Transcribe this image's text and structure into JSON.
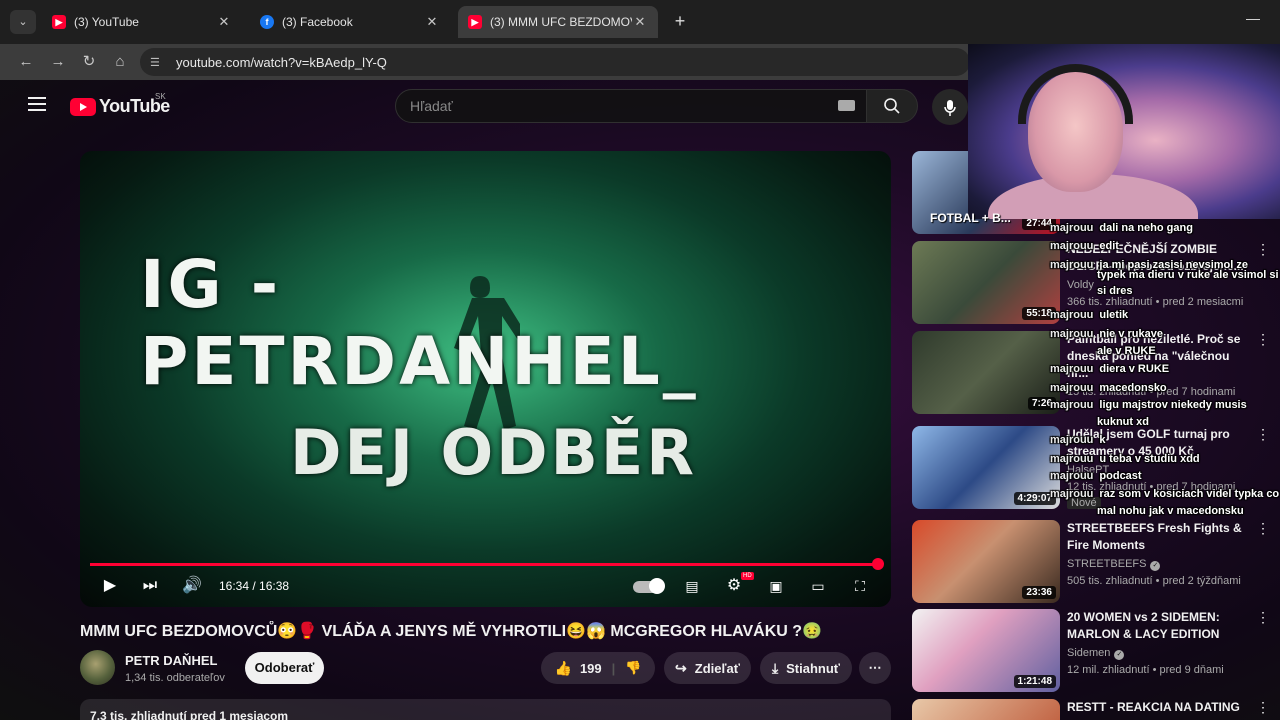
{
  "browser": {
    "tabs": [
      {
        "label": "(3) YouTube",
        "icon": "youtube-icon"
      },
      {
        "label": "(3) Facebook",
        "icon": "facebook-icon"
      },
      {
        "label": "(3) MMM UFC BEZDOMOVCŮ😳",
        "icon": "youtube-icon"
      }
    ],
    "url": "youtube.com/watch?v=kBAedp_lY-Q"
  },
  "yt": {
    "logo": "YouTube",
    "country": "SK",
    "search_placeholder": "Hľadať"
  },
  "player": {
    "overlay_line1": "IG - PETRDANHEL_",
    "overlay_line2": "DEJ ODBĚR",
    "time": "16:34 / 16:38",
    "progress": 0.996,
    "hd_badge": "HD"
  },
  "video": {
    "title": "MMM UFC BEZDOMOVCŮ😳🥊 VLÁĎA A JENYS MĚ VYHROTILI😆😱 MCGREGOR HLAVÁKU ?🤢",
    "channel": "PETR DAŇHEL",
    "subscribers": "1,34 tis. odberateľov",
    "subscribe_label": "Odoberať",
    "likes": "199",
    "share_label": "Zdieľať",
    "download_label": "Stiahnuť",
    "description_preview": "7,3 tis. zhliadnutí  pred 1 mesiacom"
  },
  "recommendations": [
    {
      "title": "FOTBAL + B...",
      "duration": "27:44",
      "channel": "",
      "meta": ""
    },
    {
      "title": "NEBEZPEČNĚJŠÍ ZOMBIE OLICE – Doprovod ozbrojené...",
      "duration": "55:18",
      "channel": "Voldy",
      "meta": "366 tis. zhliadnutí • pred 2 mesiacmi"
    },
    {
      "title": "Paintball pro neziletlé. Proč se dneska pohled na \"válečnou hr...",
      "duration": "7:26",
      "channel": "",
      "meta": "15 tis. zhliadnutí • pred 7 hodinami"
    },
    {
      "title": "Udělal jsem GOLF turnaj pro streamery o 45 000 Kč",
      "duration": "4:29:07",
      "channel": "HalsePT",
      "meta": "12 tis. zhliadnutí • pred 7 hodinami",
      "badge": "Nové"
    },
    {
      "title": "STREETBEEFS Fresh Fights & Fire Moments",
      "duration": "23:36",
      "channel": "STREETBEEFS",
      "meta": "505 tis. zhliadnutí • pred 2 týždňami"
    },
    {
      "title": "20 WOMEN vs 2 SIDEMEN: MARLON & LACY EDITION",
      "duration": "1:21:48",
      "channel": "Sidemen",
      "meta": "12 mil. zhliadnutí • pred 9 dňami"
    },
    {
      "title": "RESTT - REAKCIA NA DATING",
      "duration": "",
      "channel": "",
      "meta": ""
    }
  ],
  "chat": [
    {
      "user": "majrouu",
      "text": "dali na neho gang"
    },
    {
      "user": "majrouu",
      "text": "edit"
    },
    {
      "user": "majrouu",
      "text": "ja mi pasi zasisi nevsimol ze"
    },
    {
      "user": "",
      "text": "typek ma dieru v ruke ale vsimol si"
    },
    {
      "user": "",
      "text": "si dres"
    },
    {
      "user": "majrouu",
      "text": "uletik"
    },
    {
      "user": "majrouu",
      "text": "nie v rukave"
    },
    {
      "user": "",
      "text": "ale v RUKE"
    },
    {
      "user": "majrouu",
      "text": "diera v RUKE"
    },
    {
      "user": "majrouu",
      "text": "macedonsko"
    },
    {
      "user": "majrouu",
      "text": "ligu majstrov niekedy musis"
    },
    {
      "user": "",
      "text": "kuknut xd"
    },
    {
      "user": "majrouu",
      "text": "k"
    },
    {
      "user": "majrouu",
      "text": "u teba v studiu xdd"
    },
    {
      "user": "majrouu",
      "text": "podcast"
    },
    {
      "user": "majrouu",
      "text": "raz som v kosiciach videl typka co"
    },
    {
      "user": "",
      "text": "mal nohu jak v macedonsku"
    }
  ]
}
